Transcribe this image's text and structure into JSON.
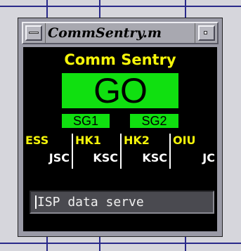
{
  "window": {
    "title": "CommSentry.m"
  },
  "app": {
    "title": "Comm Sentry",
    "status": "GO",
    "status_color": "#10e010",
    "title_color": "#f5f50a",
    "subsystems": [
      "SG1",
      "SG2"
    ]
  },
  "stations": [
    {
      "label": "ESS",
      "value": "JSC"
    },
    {
      "label": "HK1",
      "value": "KSC"
    },
    {
      "label": "HK2",
      "value": "KSC"
    },
    {
      "label": "OIU",
      "value": "JC"
    }
  ],
  "host_field": {
    "value": "ISP data serve"
  },
  "icons": {
    "menu": "window-menu-icon",
    "minimize": "minimize-icon"
  }
}
